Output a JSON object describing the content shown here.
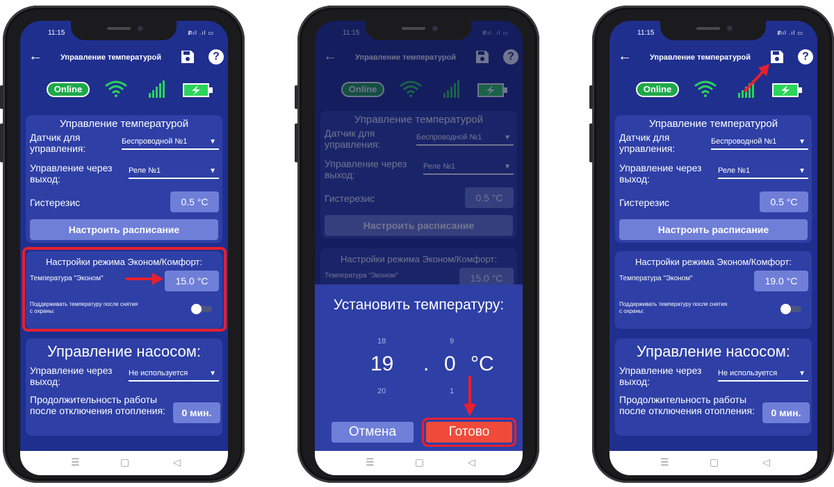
{
  "status_bar": {
    "time": "11:15",
    "icons": "ᵺıl .ıl ▭"
  },
  "app": {
    "title": "Управление температурой",
    "online_label": "Online"
  },
  "temperature_card": {
    "title": "Управление температурой",
    "sensor_label": "Датчик для управления:",
    "sensor_value": "Беспроводной №1",
    "output_label": "Управление через выход:",
    "output_value": "Реле №1",
    "hysteresis_label": "Гистерезис",
    "hysteresis_value": "0.5 °С",
    "schedule_button": "Настроить расписание"
  },
  "mode_card": {
    "title": "Настройки режима Эконом/Комфорт:",
    "econom_label": "Температура \"Эконом\"",
    "econom_value_before": "15.0 °С",
    "econom_value_after": "19.0 °С",
    "maintain_label": "Поддерживать температуру после снятия с охраны:",
    "maintain_enabled": false
  },
  "pump_card": {
    "title": "Управление насосом:",
    "output_label": "Управление через выход:",
    "output_value": "Не используется",
    "duration_label": "Продолжительность работы после отключения отопления:",
    "duration_value": "0 мин."
  },
  "set_temp_dialog": {
    "title": "Установить температуру:",
    "int_prev": "18",
    "int_value": "19",
    "int_next": "20",
    "separator": ".",
    "frac_prev": "9",
    "frac_value": "0",
    "frac_next": "1",
    "unit": "°С",
    "cancel": "Отмена",
    "done": "Готово"
  },
  "nav_bar": {
    "menu_icon": "☰",
    "home_icon": "▢",
    "back_icon": "◁"
  },
  "colors": {
    "screen_bg": "#1f2f8e",
    "card_bg": "#2e3fa6",
    "value_bg": "#6f7fd8",
    "online_green": "#1ea84a",
    "battery_green": "#2bd45a",
    "highlight_red": "#e8202e",
    "done_button": "#f04a3a"
  }
}
